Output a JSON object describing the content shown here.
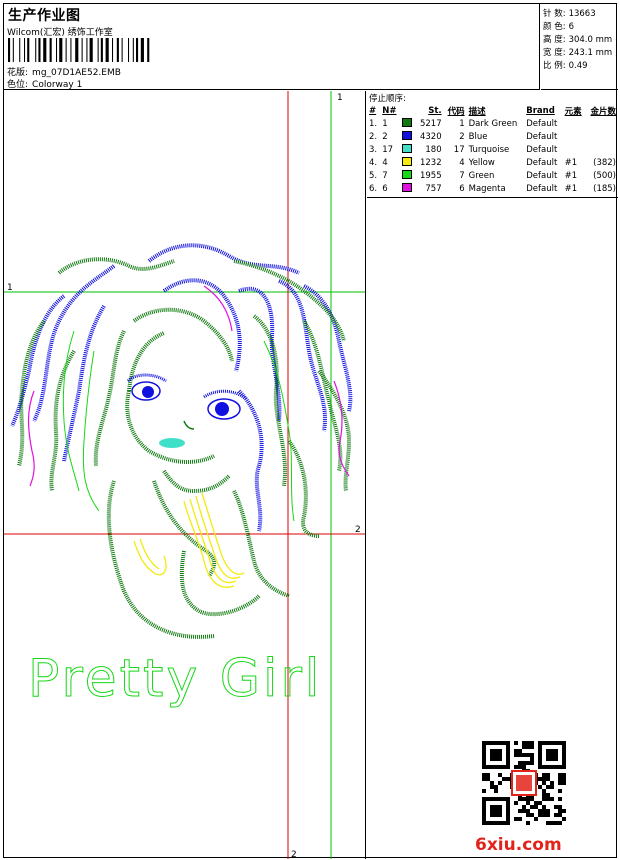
{
  "header": {
    "title": "生产作业图",
    "company": "Wilcom(汇宏) 绣饰工作室",
    "design_label": "花版:",
    "design_file": "mg_07D1AE52.EMB",
    "colorway_label": "色位:",
    "colorway": "Colorway 1"
  },
  "stats": {
    "stitches_label": "针 数:",
    "stitches": "13663",
    "colors_label": "颜 色:",
    "colors": "6",
    "height_label": "高 度:",
    "height": "304.0 mm",
    "width_label": "宽 度:",
    "width": "243.1 mm",
    "scale_label": "比 例:",
    "scale": "0.49"
  },
  "canvas": {
    "marker_1_top": "1",
    "marker_1_left": "1",
    "marker_2_right": "2",
    "marker_2_bottom": "2",
    "lettering": "Pretty Girl"
  },
  "stop_sequence": {
    "title": "停止顺序:",
    "columns": [
      "#",
      "N#",
      "St.",
      "代码",
      "描述",
      "Brand",
      "元素",
      "金片数"
    ],
    "rows": [
      {
        "num": "1.",
        "n": "1",
        "st": "5217",
        "code": "1",
        "desc": "Dark Green",
        "brand": "Default",
        "element": "",
        "sequins": "",
        "color": "#107a10"
      },
      {
        "num": "2.",
        "n": "2",
        "st": "4320",
        "code": "2",
        "desc": "Blue",
        "brand": "Default",
        "element": "",
        "sequins": "",
        "color": "#1010e0"
      },
      {
        "num": "3.",
        "n": "17",
        "st": "180",
        "code": "17",
        "desc": "Turquoise",
        "brand": "Default",
        "element": "",
        "sequins": "",
        "color": "#40e0c8"
      },
      {
        "num": "4.",
        "n": "4",
        "st": "1232",
        "code": "4",
        "desc": "Yellow",
        "brand": "Default",
        "element": "#1",
        "sequins": "(382)",
        "color": "#f4ea10"
      },
      {
        "num": "5.",
        "n": "7",
        "st": "1955",
        "code": "7",
        "desc": "Green",
        "brand": "Default",
        "element": "#1",
        "sequins": "(500)",
        "color": "#18d818"
      },
      {
        "num": "6.",
        "n": "6",
        "st": "757",
        "code": "6",
        "desc": "Magenta",
        "brand": "Default",
        "element": "#1",
        "sequins": "(185)",
        "color": "#e010e0"
      }
    ]
  },
  "watermark": {
    "num": "6",
    "text": "xiu.com"
  },
  "colors": {
    "guide_red": "#e00000",
    "guide_green": "#00c000",
    "dark_green": "#107a10",
    "blue": "#1010e0",
    "green": "#18d818",
    "magenta": "#e010e0",
    "yellow": "#f4ea10",
    "turquoise": "#40e0c8"
  }
}
